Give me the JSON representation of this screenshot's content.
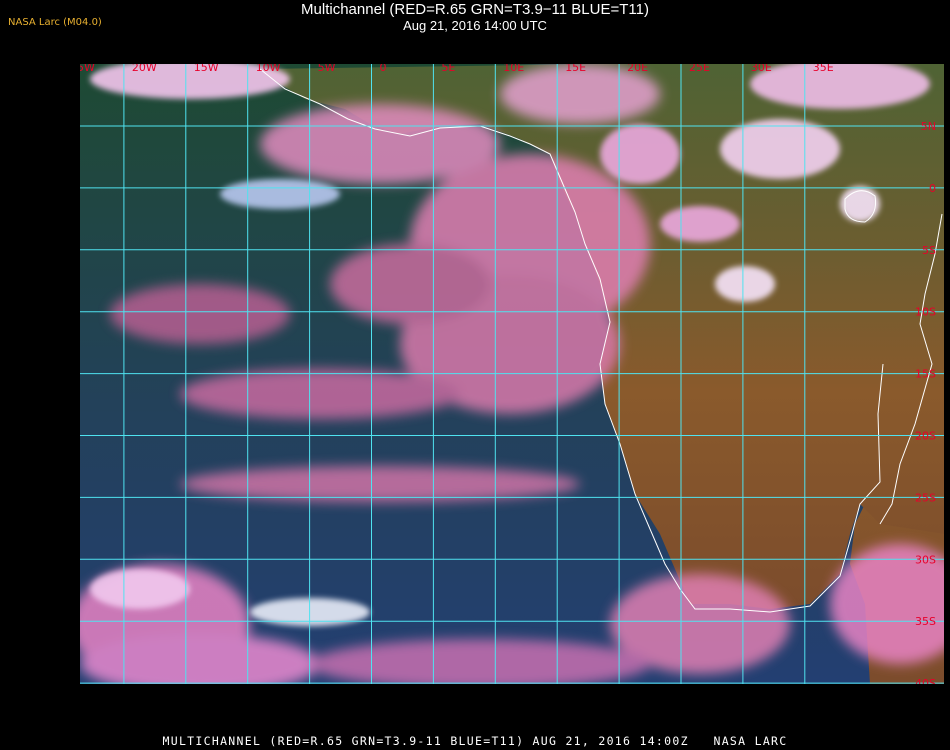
{
  "header": {
    "source_tag": "NASA Larc (M04.0)",
    "title": "Multichannel (RED=R.65 GRN=T3.9−11 BLUE=T11)",
    "subtitle": "Aug 21, 2016 14:00 UTC"
  },
  "footer": {
    "caption": "MULTICHANNEL (RED=R.65 GRN=T3.9-11 BLUE=T11) AUG 21, 2016 14:00Z   NASA LARC"
  },
  "map": {
    "grid_color": "#4fe3f0",
    "label_color": "#e8002a",
    "coast_color": "#ffffff",
    "colors": {
      "ocean_clear": "#23415a",
      "ocean_deep": "#1f3b5f",
      "land_desert": "#8a5a2c",
      "land_green": "#4d5e32",
      "low_cloud": "#e07fb2",
      "high_cloud": "#f4c6ee",
      "dark_cloud_free": "#1a3a2c"
    },
    "longitude_labels": [
      "25W",
      "20W",
      "15W",
      "10W",
      "5W",
      "0",
      "5E",
      "10E",
      "15E",
      "20E",
      "25E",
      "30E",
      "35E"
    ],
    "latitude_labels": [
      "5N",
      "0",
      "5S",
      "10S",
      "15S",
      "20S",
      "25S",
      "30S",
      "35S",
      "40S"
    ]
  }
}
